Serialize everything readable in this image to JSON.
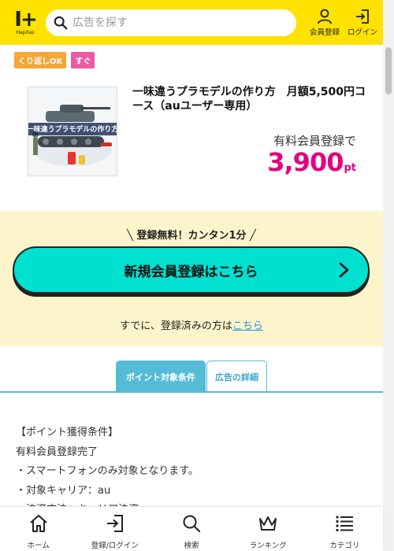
{
  "header": {
    "logo_mark": "I+",
    "logo_word": "Hapitas",
    "search_placeholder": "広告を探す",
    "register_label": "会員登録",
    "login_label": "ログイン"
  },
  "badges": [
    "くり返しOK",
    "すぐ"
  ],
  "product": {
    "image_text": "一味違うプラモデルの作り方",
    "title": "一味違うプラモデルの作り方　月額5,500円コース（auユーザー専用）",
    "condition_label": "有料会員登録で",
    "points_value": "3,900",
    "points_unit": "pt"
  },
  "register": {
    "free_tag": "登録無料！カンタン1分",
    "button_label": "新規会員登録はこちら",
    "already_prefix": "すでに、登録済みの方は",
    "already_link": "こちら"
  },
  "tabs": {
    "active": "ポイント対象条件",
    "inactive": "広告の詳細"
  },
  "conditions": [
    "【ポイント獲得条件】",
    "有料会員登録完了",
    "・スマートフォンのみ対象となります。",
    "・対象キャリア：au",
    "・決済方法：キャリア決済"
  ],
  "bottom_nav": [
    {
      "label": "ホーム",
      "icon": "home-icon"
    },
    {
      "label": "登録/ログイン",
      "icon": "login-icon"
    },
    {
      "label": "検索",
      "icon": "search-icon"
    },
    {
      "label": "ランキング",
      "icon": "crown-icon"
    },
    {
      "label": "カテゴリ",
      "icon": "list-icon"
    }
  ],
  "colors": {
    "header_bg": "#ffe200",
    "points": "#e5007f",
    "register_button": "#00e0d0",
    "register_bg": "#fcf5cc",
    "tab_accent": "#55bcd8",
    "badge_repeat": "#f4a637",
    "badge_instant": "#ea5aa2",
    "link": "#2b8fe0"
  }
}
